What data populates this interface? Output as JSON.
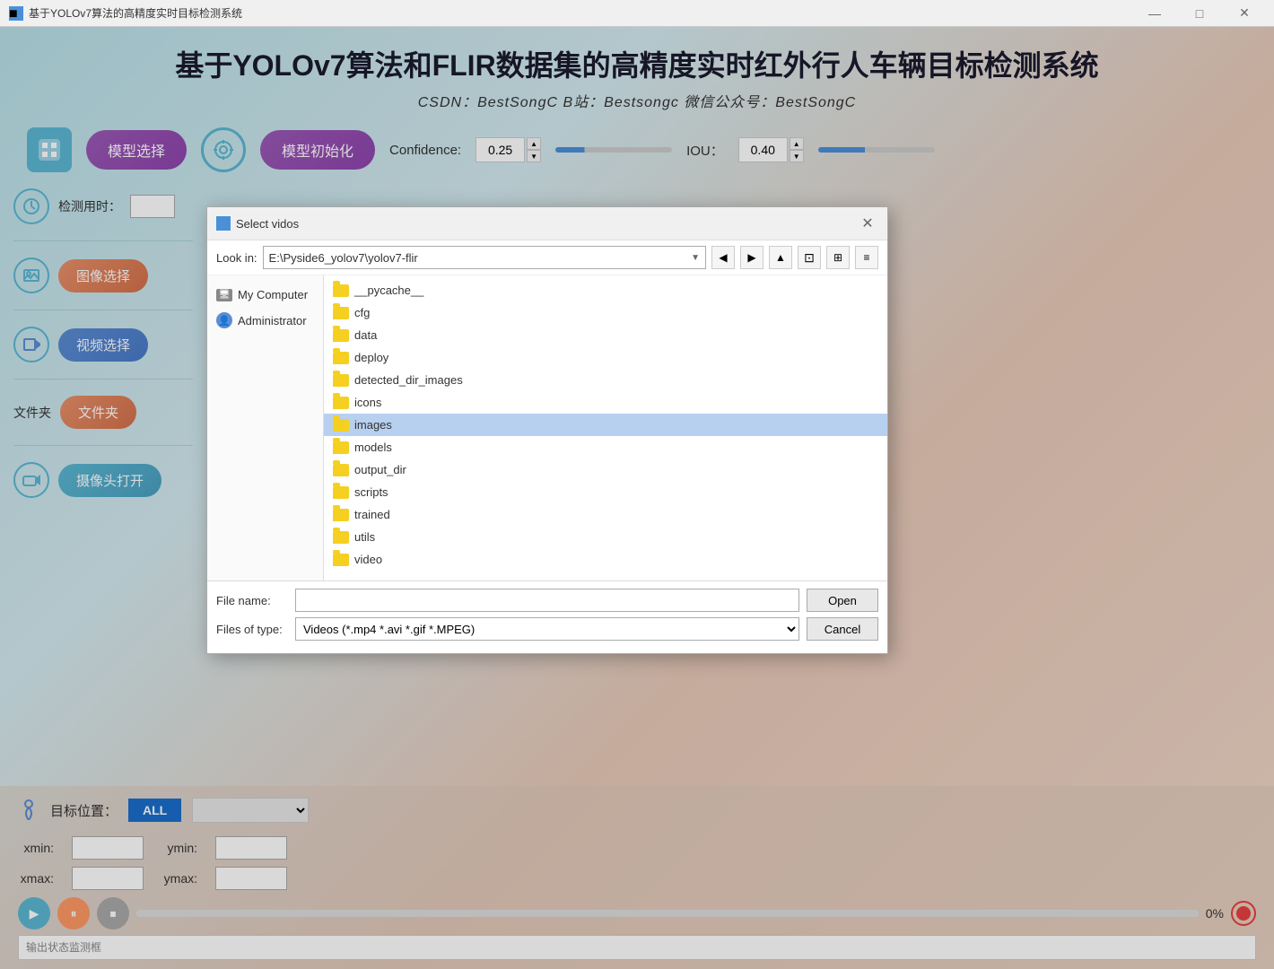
{
  "titlebar": {
    "icon": "■",
    "title": "基于YOLOv7算法的高精度实时目标检测系统",
    "min": "—",
    "max": "□",
    "close": "✕"
  },
  "header": {
    "main_title": "基于YOLOv7算法和FLIR数据集的高精度实时红外行人车辆目标检测系统",
    "subtitle": "CSDN：BestSongC   B站：Bestsongc   微信公众号：BestSongC"
  },
  "toolbar": {
    "model_select_label": "模型选择",
    "model_init_label": "模型初始化",
    "confidence_label": "Confidence:",
    "confidence_value": "0.25",
    "iou_label": "IOU：",
    "iou_value": "0.40"
  },
  "sidebar": {
    "detect_time_label": "检测用时：",
    "image_select_label": "图像选择",
    "video_select_label": "视频选择",
    "folder_label": "文件夹",
    "folder_btn_label": "文件夹",
    "camera_label": "摄像头打开"
  },
  "bottom": {
    "target_label": "目标位置：",
    "all_btn": "ALL",
    "xmin_label": "xmin:",
    "ymin_label": "ymin:",
    "xmax_label": "xmax:",
    "ymax_label": "ymax:",
    "progress": "0%",
    "status_placeholder": "输出状态监测框"
  },
  "dialog": {
    "title": "Select vidos",
    "look_in_label": "Look in:",
    "look_in_path": "E:\\Pyside6_yolov7\\yolov7-flir",
    "left_panel": [
      {
        "label": "My Computer",
        "type": "pc"
      },
      {
        "label": "Administrator",
        "type": "user"
      }
    ],
    "files": [
      {
        "name": "__pycache__",
        "selected": false
      },
      {
        "name": "cfg",
        "selected": false
      },
      {
        "name": "data",
        "selected": false
      },
      {
        "name": "deploy",
        "selected": false
      },
      {
        "name": "detected_dir_images",
        "selected": false
      },
      {
        "name": "icons",
        "selected": false
      },
      {
        "name": "images",
        "selected": true
      },
      {
        "name": "models",
        "selected": false
      },
      {
        "name": "output_dir",
        "selected": false
      },
      {
        "name": "scripts",
        "selected": false
      },
      {
        "name": "trained",
        "selected": false
      },
      {
        "name": "utils",
        "selected": false
      },
      {
        "name": "video",
        "selected": false
      }
    ],
    "file_name_label": "File name:",
    "file_name_value": "",
    "open_btn": "Open",
    "files_of_type_label": "Files of type:",
    "files_of_type_value": "Videos (*.mp4 *.avi *.gif *.MPEG)",
    "cancel_btn": "Cancel"
  }
}
